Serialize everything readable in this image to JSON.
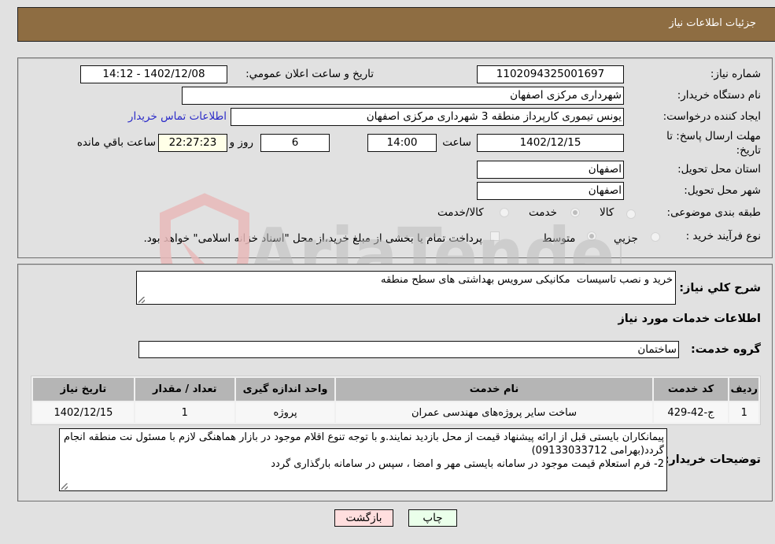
{
  "header": {
    "title": "جزئیات اطلاعات نیاز"
  },
  "form": {
    "need_number_label": "شماره نیاز:",
    "need_number": "1102094325001697",
    "announce_label": "تاریخ و ساعت اعلان عمومي:",
    "announce_value": "1402/12/08 - 14:12",
    "buyer_org_label": "نام دستگاه خریدار:",
    "buyer_org": "شهرداری مرکزی اصفهان",
    "creator_label": "ایجاد کننده درخواست:",
    "creator": "یونس تیموری کارپرداز منطقه 3 شهرداری مرکزی اصفهان",
    "contact_link": "اطلاعات تماس خریدار",
    "deadline_label_line1": "مهلت ارسال پاسخ: تا",
    "deadline_label_line2": "تاریخ:",
    "deadline_date": "1402/12/15",
    "time_label": "ساعت",
    "deadline_time": "14:00",
    "days_value": "6",
    "days_label": "روز و",
    "remaining_time": "22:27:23",
    "remaining_label": "ساعت باقي مانده",
    "province_label": "استان محل تحویل:",
    "province": "اصفهان",
    "city_label": "شهر محل تحویل:",
    "city": "اصفهان",
    "category_label": "طبقه بندی موضوعی:",
    "category_options": [
      {
        "label": "کالا",
        "selected": false
      },
      {
        "label": "خدمت",
        "selected": true
      },
      {
        "label": "کالا/خدمت",
        "selected": false
      }
    ],
    "purchase_type_label": "نوع فرآیند خرید :",
    "purchase_type_options": [
      {
        "label": "جزيي",
        "selected": false
      },
      {
        "label": "متوسط",
        "selected": true
      }
    ],
    "treasury_checkbox_checked": false,
    "treasury_note": "پرداخت تمام یا بخشی از مبلغ خرید،از محل \"اسناد خزانه اسلامی\" خواهد بود."
  },
  "details": {
    "summary_label": "شرح كلي نياز:",
    "summary": "خرید و نصب تاسیسات  مکانیکی سرویس بهداشتی های سطح منطقه",
    "services_heading": "اطلاعات خدمات مورد نیاز",
    "service_group_label": "گروه خدمت:",
    "service_group": "ساختمان",
    "table": {
      "headers": [
        "ردیف",
        "کد خدمت",
        "نام خدمت",
        "واحد اندازه گیری",
        "تعداد / مقدار",
        "تاریخ نیاز"
      ],
      "rows": [
        [
          "1",
          "ج-42-429",
          "ساخت سایر پروژه‌های مهندسی عمران",
          "پروژه",
          "1",
          "1402/12/15"
        ]
      ]
    },
    "buyer_notes_label": "توضیحات خریدار:",
    "buyer_notes": "پیمانکاران بایستی قبل از ارائه پیشنهاد قیمت از محل بازدید نمایند.و با توجه تنوع اقلام موجود در بازار هماهنگی لازم با مسئول نت منطقه انجام گردد(بهرامی 09133033712)\n2- فرم استعلام قیمت موجود در سامانه بایستی مهر و امضا ، سپس در سامانه بارگذاری گردد"
  },
  "buttons": {
    "print": "چاپ",
    "back": "بازگشت"
  },
  "colors": {
    "header_bg": "#8e6d42",
    "print_bg": "#eaffea",
    "back_bg": "#ffdede",
    "link": "#2a2ac8"
  },
  "watermark": {
    "text": "AriaTender.neT"
  }
}
